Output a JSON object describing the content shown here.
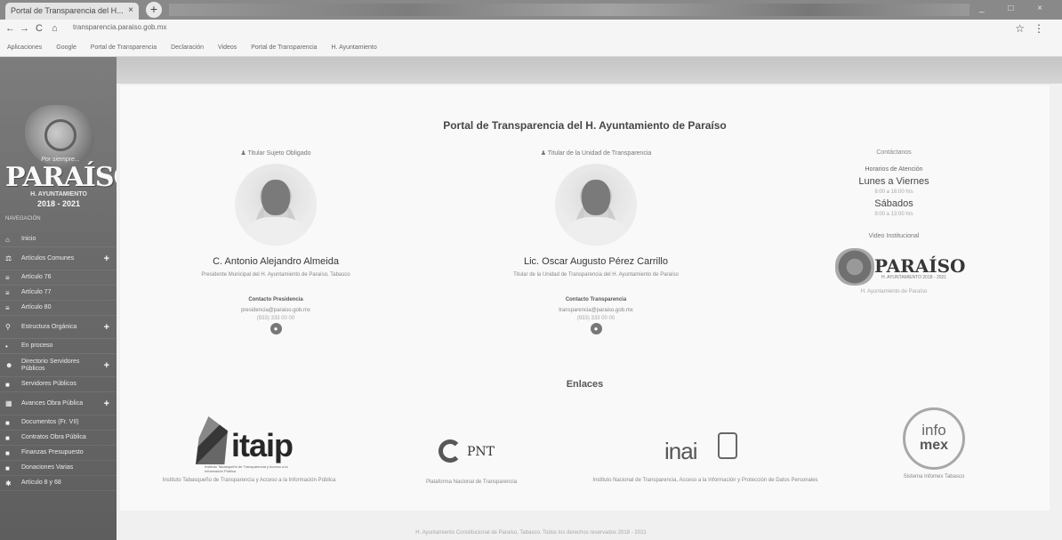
{
  "browser": {
    "tab_title": "Portal de Transparencia del H...",
    "tab_close": "×",
    "new_tab": "+",
    "back": "←",
    "forward": "→",
    "reload": "C",
    "home": "⌂",
    "url": "transparencia.paraiso.gob.mx",
    "bookmark_icon": "☆",
    "menu_icon": "⋮",
    "bookmarks": [
      "Aplicaciones",
      "Google",
      "Portal de Transparencia",
      "Declaración",
      "Videos",
      "Portal de Transparencia",
      "H. Ayuntamiento"
    ]
  },
  "sidebar": {
    "brand_small": "Por siempre...",
    "brand_big": "PARAÍSO",
    "brand_sub": "H. AYUNTAMIENTO",
    "brand_years": "2018 - 2021",
    "nav_title": "NAVEGACIÓN",
    "items": [
      {
        "icon": "house-icon",
        "glyph": "⌂",
        "label": "Inicio",
        "plus": ""
      },
      {
        "icon": "gavel-icon",
        "glyph": "⚖",
        "label": "Artículos Comunes",
        "plus": "+"
      },
      {
        "icon": "list-icon",
        "glyph": "≡",
        "label": "Artículo 76",
        "plus": ""
      },
      {
        "icon": "list-icon",
        "glyph": "≡",
        "label": "Artículo 77",
        "plus": ""
      },
      {
        "icon": "list-icon",
        "glyph": "≡",
        "label": "Artículo 80",
        "plus": ""
      },
      {
        "icon": "search-icon",
        "glyph": "⚲",
        "label": "Estructura Orgánica",
        "plus": "+"
      },
      {
        "icon": "dot-icon",
        "glyph": "•",
        "label": "En proceso",
        "plus": ""
      },
      {
        "icon": "user-icon",
        "glyph": "☻",
        "label": "Directorio Servidores Públicos",
        "plus": "+"
      },
      {
        "icon": "briefcase-icon",
        "glyph": "■",
        "label": "Servidores Públicos",
        "plus": ""
      },
      {
        "icon": "grid-icon",
        "glyph": "▦",
        "label": "Avances Obra Pública",
        "plus": "+"
      },
      {
        "icon": "folder-icon",
        "glyph": "■",
        "label": "Documentos (Fr. VII)",
        "plus": ""
      },
      {
        "icon": "folder-icon",
        "glyph": "■",
        "label": "Contratos Obra Pública",
        "plus": ""
      },
      {
        "icon": "folder-icon",
        "glyph": "■",
        "label": "Finanzas Presupuesto",
        "plus": ""
      },
      {
        "icon": "folder-icon",
        "glyph": "■",
        "label": "Donaciones Varias",
        "plus": ""
      },
      {
        "icon": "star-icon",
        "glyph": "✱",
        "label": "Artículo 8 y 68",
        "plus": ""
      }
    ]
  },
  "main": {
    "title": "Portal de Transparencia del H. Ayuntamiento de Paraíso",
    "persons": [
      {
        "role": "Titular Sujeto Obligado",
        "name": "C. Antonio Alejandro Almeida",
        "desc": "Presidente Municipal del H. Ayuntamiento de Paraíso, Tabasco",
        "who": "Contacto Presidencia",
        "email": "presidencia@paraiso.gob.mx",
        "phone": "(933) 333 00 00",
        "dot": "●"
      },
      {
        "role": "Titular de la Unidad de Transparencia",
        "name": "Lic. Oscar Augusto Pérez Carrillo",
        "desc": "Titular de la Unidad de Transparencia del H. Ayuntamiento de Paraíso",
        "who": "Contacto Transparencia",
        "email": "transparencia@paraiso.gob.mx",
        "phone": "(933) 333 00 00",
        "dot": "●"
      }
    ],
    "right": {
      "contact": "Contáctanos",
      "schedule": "Horarios de Atención",
      "day1": "Lunes a Viernes",
      "hours1": "8:00 a 16:00 hrs",
      "day2": "Sábados",
      "hours2": "9:00 a 13:00 hrs",
      "video": "Video Institucional",
      "logo_text": "PARAÍSO",
      "logo_sub": "H. AYUNTAMIENTO 2018 - 2021",
      "caption": "H. Ayuntamiento de Paraíso"
    },
    "links_title": "Enlaces",
    "links": [
      {
        "logo": "itaip",
        "word": "itaip",
        "small": "Instituto Tabasqueño de Transparencia y Acceso a la Información Pública",
        "caption": "Instituto Tabasqueño de Transparencia y Acceso a la Información Pública"
      },
      {
        "logo": "pnt",
        "word": "PNT",
        "caption": "Plataforma Nacional de Transparencia"
      },
      {
        "logo": "inai",
        "word": "inai",
        "caption": "Instituto Nacional de Transparencia, Acceso a la Información y Protección de Datos Personales"
      },
      {
        "logo": "infomex",
        "word1": "info",
        "word2": "mex",
        "caption": "Sistema Infomex Tabasco"
      }
    ]
  },
  "footer": "H. Ayuntamiento Constitucional de Paraíso, Tabasco. Todos los derechos reservados 2018 - 2021"
}
